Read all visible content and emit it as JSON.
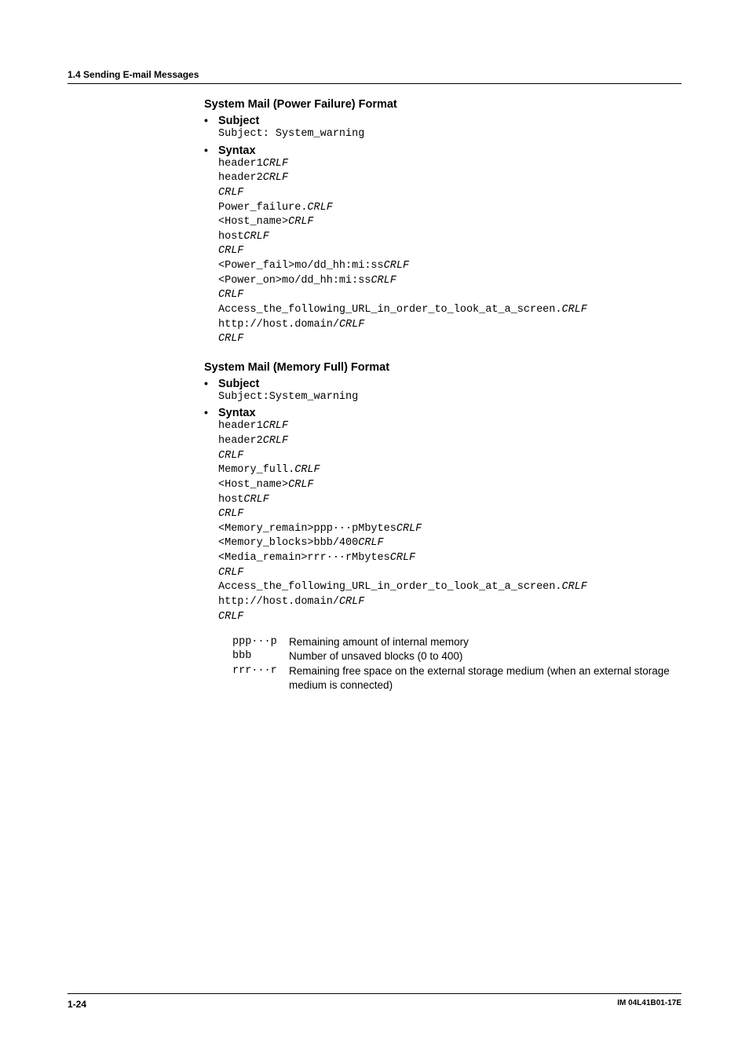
{
  "header": {
    "section_ref": "1.4  Sending E-mail Messages"
  },
  "power_failure": {
    "title": "System Mail (Power Failure) Format",
    "subject_label": "Subject",
    "subject_line": "Subject: System_warning",
    "syntax_label": "Syntax",
    "lines": [
      {
        "t": "header1",
        "crlf": true
      },
      {
        "t": "header2",
        "crlf": true
      },
      {
        "t": "",
        "crlf": true
      },
      {
        "t": "Power_failure.",
        "crlf": true
      },
      {
        "t": "<Host_name>",
        "crlf": true
      },
      {
        "t": "host",
        "crlf": true
      },
      {
        "t": "",
        "crlf": true
      },
      {
        "t": "<Power_fail>mo/dd_hh:mi:ss",
        "crlf": true
      },
      {
        "t": "<Power_on>mo/dd_hh:mi:ss",
        "crlf": true
      },
      {
        "t": "",
        "crlf": true
      },
      {
        "t": "Access_the_following_URL_in_order_to_look_at_a_screen.",
        "crlf": true
      },
      {
        "t": "http://host.domain/",
        "crlf": true
      },
      {
        "t": "",
        "crlf": true
      }
    ]
  },
  "memory_full": {
    "title": "System Mail (Memory Full) Format",
    "subject_label": "Subject",
    "subject_line": "Subject:System_warning",
    "syntax_label": "Syntax",
    "lines": [
      {
        "t": "header1",
        "crlf": true
      },
      {
        "t": "header2",
        "crlf": true
      },
      {
        "t": "",
        "crlf": true
      },
      {
        "t": "Memory_full.",
        "crlf": true
      },
      {
        "t": "<Host_name>",
        "crlf": true
      },
      {
        "t": "host",
        "crlf": true
      },
      {
        "t": "",
        "crlf": true
      },
      {
        "t": "<Memory_remain>ppp···pMbytes",
        "crlf": true
      },
      {
        "t": "<Memory_blocks>bbb/400",
        "crlf": true
      },
      {
        "t": "<Media_remain>rrr···rMbytes",
        "crlf": true
      },
      {
        "t": "",
        "crlf": true
      },
      {
        "t": "Access_the_following_URL_in_order_to_look_at_a_screen.",
        "crlf": true
      },
      {
        "t": "http://host.domain/",
        "crlf": true
      },
      {
        "t": "",
        "crlf": true
      }
    ],
    "legend": [
      {
        "k": "ppp···p",
        "v": "Remaining amount of internal memory"
      },
      {
        "k": "bbb",
        "v": "Number of unsaved blocks (0 to 400)"
      },
      {
        "k": "rrr···r",
        "v": "Remaining free space on the external storage medium (when an external storage medium is connected)"
      }
    ]
  },
  "footer": {
    "page": "1-24",
    "doc": "IM 04L41B01-17E"
  },
  "crlf_text": "CRLF"
}
